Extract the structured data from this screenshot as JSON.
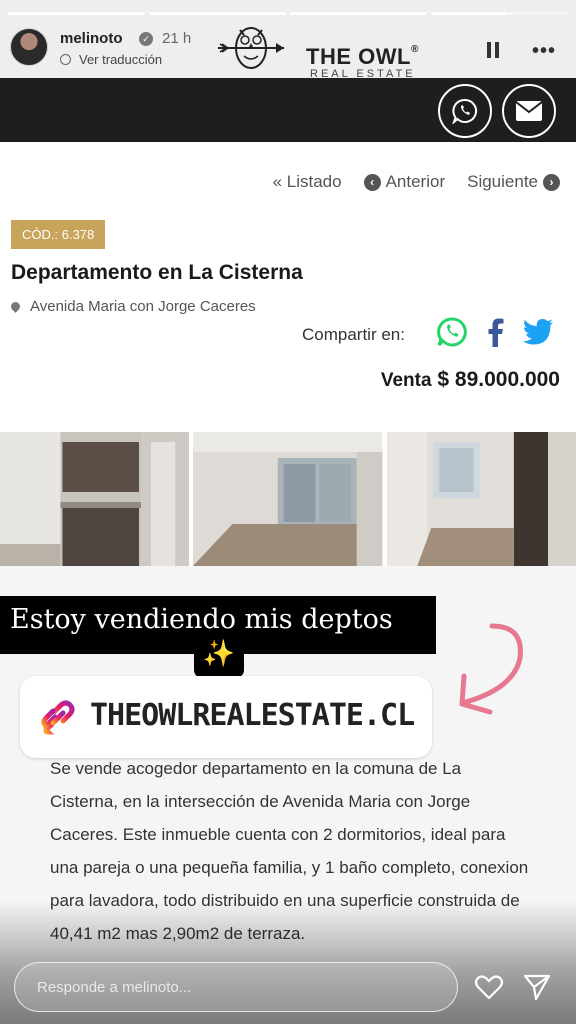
{
  "story": {
    "username": "melinoto",
    "time": "21 h",
    "translate_label": "Ver traducción",
    "progress": [
      1,
      1,
      1,
      0.55
    ]
  },
  "brand": {
    "name": "THE OWL",
    "subtitle": "REAL ESTATE",
    "reg": "®"
  },
  "icons": {
    "whatsapp": "whatsapp-icon",
    "email": "envelope-icon",
    "facebook": "facebook-icon",
    "twitter": "twitter-icon"
  },
  "nav": {
    "listing": "« Listado",
    "previous": "Anterior",
    "next": "Siguiente"
  },
  "listing": {
    "code": "CÓD.: 6.378",
    "title": "Departamento en La Cisterna",
    "address": "Avenida Maria con Jorge Caceres",
    "share_label": "Compartir en:",
    "price_label": "Venta",
    "price": "$ 89.000.000"
  },
  "overlay": {
    "caption": "Estoy vendiendo mis deptos",
    "sparkle": "✨"
  },
  "link_sticker": {
    "text": "THEOWLREALESTATE.CL"
  },
  "description": "Se vende acogedor departamento en la comuna de La Cisterna, en la intersección de Avenida Maria con Jorge Caceres. Este inmueble cuenta con 2 dormitorios, ideal para una pareja o una pequeña familia, y 1 baño completo, conexion para lavadora, todo distribuido en una superficie construida de 40,41 m2 mas 2,90m2 de terraza.",
  "reply": {
    "placeholder": "Responde a melinoto..."
  },
  "colors": {
    "badge": "#c8a45a",
    "whatsapp": "#25d366",
    "facebook": "#3b5998",
    "twitter": "#1da1f2",
    "dark_bar": "#1e1e1e"
  }
}
